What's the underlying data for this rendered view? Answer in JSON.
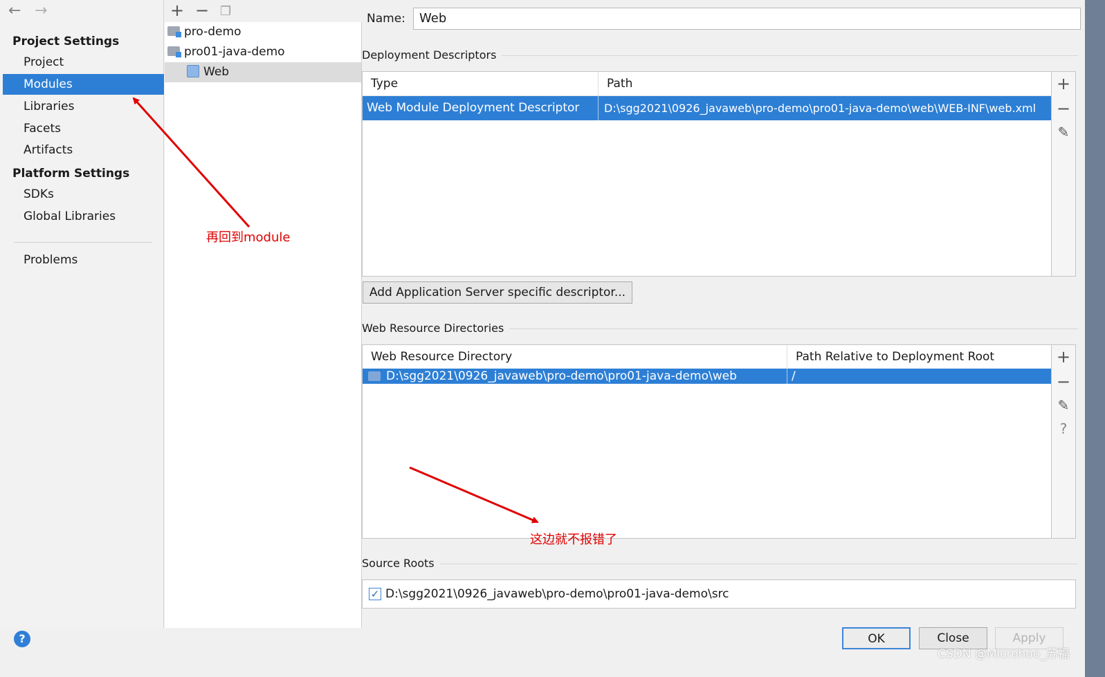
{
  "sidebar": {
    "project_settings_heading": "Project Settings",
    "project_items": [
      "Project",
      "Modules",
      "Libraries",
      "Facets",
      "Artifacts"
    ],
    "platform_settings_heading": "Platform Settings",
    "platform_items": [
      "SDKs",
      "Global Libraries"
    ],
    "problems_label": "Problems",
    "selected_item": "Modules"
  },
  "tree": {
    "items": [
      {
        "label": "pro-demo",
        "icon": "folder-module-icon"
      },
      {
        "label": "pro01-java-demo",
        "icon": "folder-module-icon"
      },
      {
        "label": "Web",
        "icon": "web-facet-icon"
      }
    ],
    "selected": "Web"
  },
  "content": {
    "name_label": "Name:",
    "name_value": "Web",
    "deployment": {
      "title": "Deployment Descriptors",
      "columns": [
        "Type",
        "Path"
      ],
      "rows": [
        {
          "type": "Web Module Deployment Descriptor",
          "path": "D:\\sgg2021\\0926_javaweb\\pro-demo\\pro01-java-demo\\web\\WEB-INF\\web.xml"
        }
      ],
      "add_server_button": "Add Application Server specific descriptor..."
    },
    "web_resources": {
      "title": "Web Resource Directories",
      "columns": [
        "Web Resource Directory",
        "Path Relative to Deployment Root"
      ],
      "rows": [
        {
          "directory": "D:\\sgg2021\\0926_javaweb\\pro-demo\\pro01-java-demo\\web",
          "relative": "/"
        }
      ]
    },
    "source_roots": {
      "title": "Source Roots",
      "items": [
        {
          "path": "D:\\sgg2021\\0926_javaweb\\pro-demo\\pro01-java-demo\\src",
          "checked": true
        }
      ]
    }
  },
  "buttons": {
    "ok": "OK",
    "close": "Close",
    "apply": "Apply"
  },
  "annotations": {
    "note_module": "再回到module",
    "note_no_error": "这边就不报错了",
    "watermark": "CSDN @Microhoo_苏福",
    "arrow_color": "#e00000"
  },
  "colors": {
    "selection": "#2d7fd5",
    "accent_border": "#3c84d8"
  }
}
